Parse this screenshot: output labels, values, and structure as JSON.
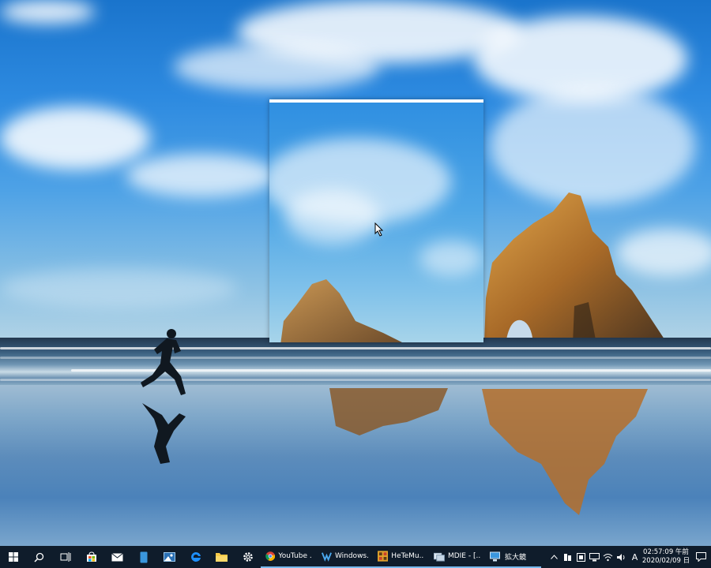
{
  "taskbar": {
    "start_icon": "windows-logo-icon",
    "pinned": [
      {
        "icon": "search-icon"
      },
      {
        "icon": "task-view-icon"
      },
      {
        "icon": "store-icon"
      },
      {
        "icon": "mail-icon"
      },
      {
        "icon": "phone-icon"
      },
      {
        "icon": "photo-icon"
      },
      {
        "icon": "edge-icon"
      },
      {
        "icon": "file-explorer-icon"
      },
      {
        "icon": "settings-gear-icon"
      }
    ],
    "apps": [
      {
        "icon": "chrome-icon",
        "label": "YouTube ..."
      },
      {
        "icon": "windows-app-icon",
        "label": "Windows..."
      },
      {
        "icon": "hetemu-icon",
        "label": "HeTeMu..."
      },
      {
        "icon": "mdie-icon",
        "label": "MDIE - [..."
      },
      {
        "icon": "magnifier-icon",
        "label": "拡大鏡"
      }
    ],
    "tray": {
      "ime_label": "A",
      "clock_time": "02:57:09 午前",
      "clock_date": "2020/02/09 日"
    }
  },
  "colors": {
    "taskbar_bg": "#0f1c2b",
    "accent": "#76b9ed",
    "magnifier_border": "#ffffff"
  }
}
